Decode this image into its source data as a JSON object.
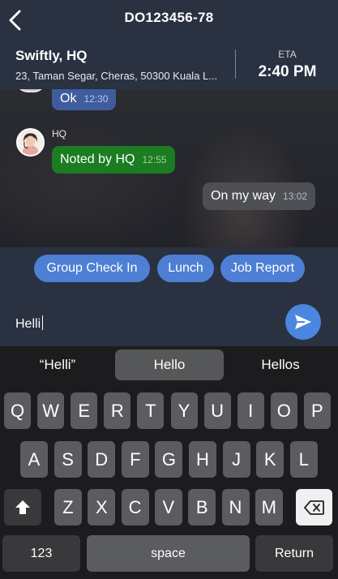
{
  "header": {
    "title": "DO123456-78",
    "destination": "Swiftly, HQ",
    "address": "23, Taman Segar, Cheras, 50300 Kuala L...",
    "eta_label": "ETA",
    "eta_value": "2:40 PM"
  },
  "messages": [
    {
      "text": "Ok",
      "time": "12:30"
    },
    {
      "sender": "HQ",
      "text": "Noted by HQ",
      "time": "12:55"
    },
    {
      "text": "On my way",
      "time": "13:02"
    }
  ],
  "quick_replies": [
    "Group Check In",
    "Lunch",
    "Job Report"
  ],
  "composer": {
    "value": "Helli"
  },
  "keyboard": {
    "suggestions": [
      "“Helli”",
      "Hello",
      "Hellos"
    ],
    "row1": [
      "Q",
      "W",
      "E",
      "R",
      "T",
      "Y",
      "U",
      "I",
      "O",
      "P"
    ],
    "row2": [
      "A",
      "S",
      "D",
      "F",
      "G",
      "H",
      "J",
      "K",
      "L"
    ],
    "row3": [
      "Z",
      "X",
      "C",
      "V",
      "B",
      "N",
      "M"
    ],
    "numbers_label": "123",
    "space_label": "space",
    "return_label": "Return"
  },
  "colors": {
    "header_bg": "#2a3141",
    "incoming_bubble": "#3f5c9d",
    "hq_bubble": "#1b7c21",
    "outgoing_bubble": "#4d4f55",
    "chip_bg": "#4d7fd4",
    "send_button": "#4b86e0"
  },
  "icons": {
    "back": "chevron-left-icon",
    "send": "paper-plane-icon",
    "shift": "shift-arrow-icon",
    "delete": "backspace-icon"
  }
}
